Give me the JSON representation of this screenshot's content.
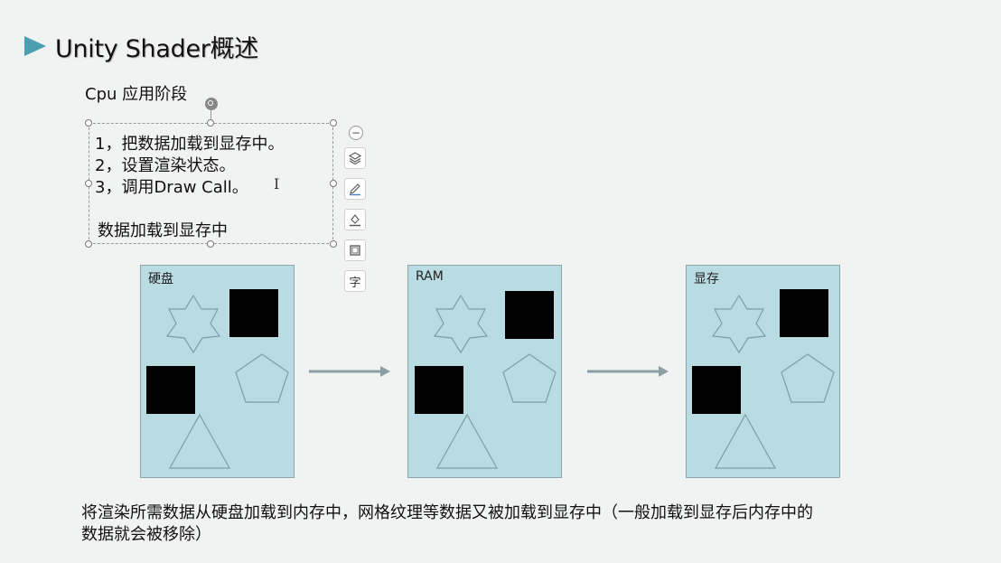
{
  "slide": {
    "title": "Unity Shader概述",
    "subtitle": "Cpu 应用阶段"
  },
  "textbox": {
    "lines": [
      "1，把数据加载到显存中。",
      "2，设置渲染状态。",
      "3，调用Draw Call。",
      "数据加载到显存中"
    ]
  },
  "toolbar": {
    "tools": [
      {
        "icon": "layers-icon"
      },
      {
        "icon": "pen-icon"
      },
      {
        "icon": "fill-icon"
      },
      {
        "icon": "outline-icon"
      },
      {
        "icon": "text-icon",
        "glyph": "字"
      }
    ],
    "collapse_icon": "minus-icon"
  },
  "panels": [
    {
      "label": "硬盘"
    },
    {
      "label": "RAM"
    },
    {
      "label": "显存"
    }
  ],
  "caption": {
    "line1": "将渲染所需数据从硬盘加载到内存中，网格纹理等数据又被加载到显存中（一般加载到显存后内存中的",
    "line2": "数据就会被移除）"
  },
  "colors": {
    "accent": "#4a9fb0",
    "panel_fill": "#b9dbe2",
    "shape_stroke": "#7d9ea5",
    "arrow": "#8a9ea3"
  }
}
